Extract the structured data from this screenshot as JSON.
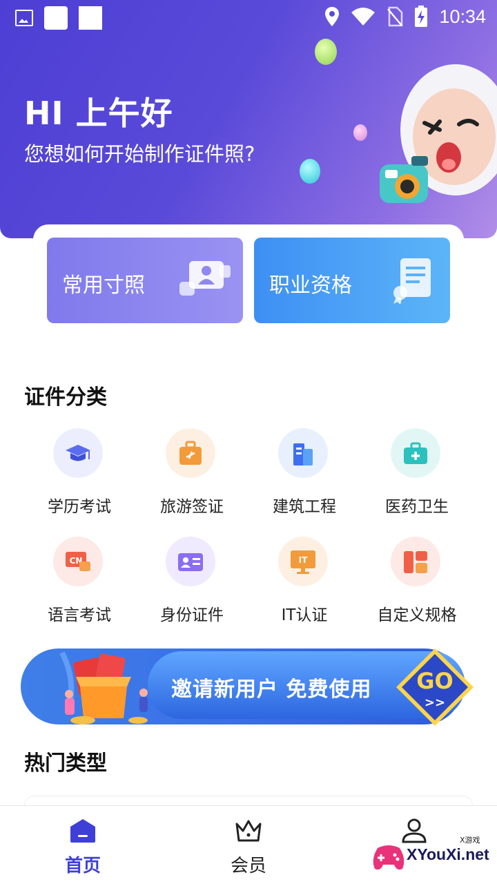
{
  "status_bar": {
    "time": "10:34"
  },
  "header": {
    "greeting": "HI 上午好",
    "subtitle": "您想如何开始制作证件照?"
  },
  "cards": [
    {
      "label": "常用寸照",
      "icon": "portrait-photo-icon"
    },
    {
      "label": "职业资格",
      "icon": "certificate-icon"
    }
  ],
  "sections": {
    "categories": "证件分类",
    "hot": "热门类型"
  },
  "categories": [
    {
      "label": "学历考试",
      "icon": "graduation-cap-icon",
      "color": "#5b6cf0"
    },
    {
      "label": "旅游签证",
      "icon": "travel-bag-icon",
      "color": "#f39a3b"
    },
    {
      "label": "建筑工程",
      "icon": "building-icon",
      "color": "#3d8ff0"
    },
    {
      "label": "医药卫生",
      "icon": "medical-kit-icon",
      "color": "#2cc1bd"
    },
    {
      "label": "语言考试",
      "icon": "language-cn-icon",
      "color": "#f06048"
    },
    {
      "label": "身份证件",
      "icon": "id-card-icon",
      "color": "#8b6df0"
    },
    {
      "label": "IT认证",
      "icon": "it-monitor-icon",
      "color": "#f39a3b"
    },
    {
      "label": "自定义规格",
      "icon": "custom-layout-icon",
      "color": "#f06048"
    }
  ],
  "banner": {
    "text": "邀请新用户 免费使用",
    "go": "GO",
    "arrows": ">>"
  },
  "bottom_nav": [
    {
      "label": "首页",
      "icon": "home-icon",
      "active": true
    },
    {
      "label": "会员",
      "icon": "crown-icon",
      "active": false
    },
    {
      "label": "",
      "icon": "profile-icon",
      "active": false
    }
  ],
  "watermark": {
    "text": "XYouXi.net",
    "small": "X游戏"
  },
  "colors": {
    "primary": "#4a3fc6",
    "active_nav": "#3f3fd8"
  }
}
